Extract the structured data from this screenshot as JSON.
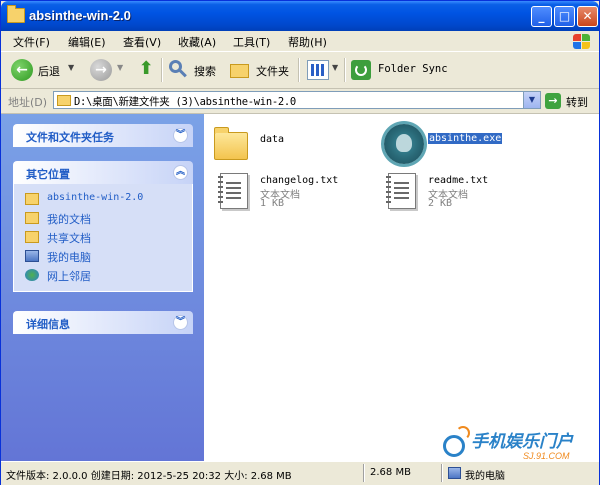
{
  "window": {
    "title": "absinthe-win-2.0"
  },
  "menu": [
    "文件(F)",
    "编辑(E)",
    "查看(V)",
    "收藏(A)",
    "工具(T)",
    "帮助(H)"
  ],
  "toolbar": {
    "back": "后退",
    "search": "搜索",
    "folders": "文件夹",
    "folder_sync": "Folder Sync"
  },
  "address": {
    "label": "地址(D)",
    "path": "D:\\桌面\\新建文件夹 (3)\\absinthe-win-2.0",
    "go": "转到"
  },
  "tasks": {
    "file_tasks": {
      "title": "文件和文件夹任务"
    },
    "other_places": {
      "title": "其它位置",
      "items": [
        "absinthe-win-2.0",
        "我的文档",
        "共享文档",
        "我的电脑",
        "网上邻居"
      ]
    },
    "details": {
      "title": "详细信息"
    }
  },
  "files": [
    {
      "name": "data",
      "type": "folder"
    },
    {
      "name": "absinthe.exe",
      "type": "exe",
      "selected": true
    },
    {
      "name": "changelog.txt",
      "kind": "文本文档",
      "size": "1 KB"
    },
    {
      "name": "readme.txt",
      "kind": "文本文档",
      "size": "2 KB"
    }
  ],
  "status": {
    "info": "文件版本: 2.0.0.0 创建日期: 2012-5-25 20:32 大小: 2.68 MB",
    "size": "2.68 MB",
    "location": "我的电脑"
  },
  "watermark": {
    "text": "手机娱乐门户",
    "url": "SJ.91.COM"
  },
  "colors": {
    "titlebar": "#0054e3",
    "taskpane": "#7ba2e7",
    "link": "#215dc6",
    "selection": "#316ac5"
  }
}
